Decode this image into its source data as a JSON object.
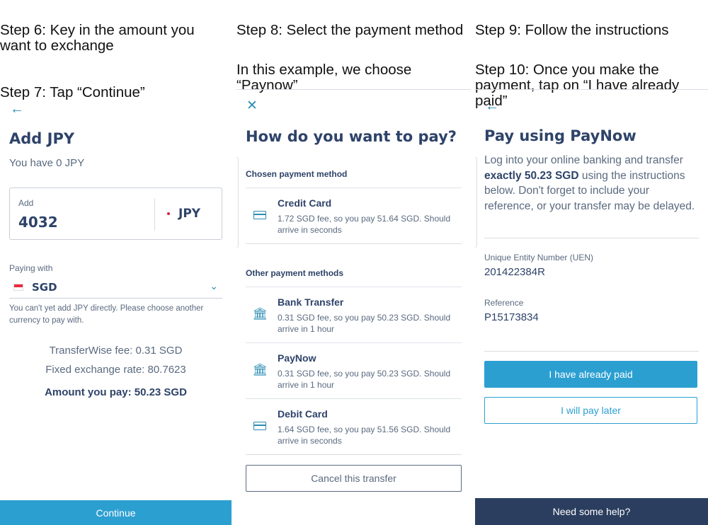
{
  "col1": {
    "caption_a": "Step 6: Key in the amount you\nwant to exchange",
    "caption_b": "Step 7: Tap “Continue”",
    "back_icon": "arrow-left-icon",
    "title": "Add JPY",
    "balance": "You have 0 JPY",
    "amount_label": "Add",
    "amount_value": "4032",
    "amount_currency": "JPY",
    "paying_with_label": "Paying with",
    "paying_with_currency": "SGD",
    "notice": "You can't yet add JPY directly. Please choose another currency to pay with.",
    "fee": "TransferWise fee: 0.31 SGD",
    "rate": "Fixed exchange rate: 80.7623",
    "total": "Amount you pay: 50.23 SGD",
    "continue_label": "Continue"
  },
  "col2": {
    "caption_a": "Step 8: Select the payment method",
    "caption_b": "In this example, we choose\n“Paynow”",
    "close_icon": "close-icon",
    "title": "How do you want to pay?",
    "chosen_head": "Chosen payment method",
    "chosen": {
      "name": "Credit Card",
      "desc": "1.72 SGD fee, so you pay 51.64 SGD. Should arrive in seconds",
      "icon": "credit-card-icon"
    },
    "other_head": "Other payment methods",
    "others": [
      {
        "name": "Bank Transfer",
        "desc": "0.31 SGD fee, so you pay 50.23 SGD. Should arrive in 1 hour",
        "icon": "bank-icon"
      },
      {
        "name": "PayNow",
        "desc": "0.31 SGD fee, so you pay 50.23 SGD. Should arrive in 1 hour",
        "icon": "bank-icon"
      },
      {
        "name": "Debit Card",
        "desc": "1.64 SGD fee, so you pay 51.56 SGD. Should arrive in seconds",
        "icon": "credit-card-icon"
      }
    ],
    "cancel_label": "Cancel this transfer"
  },
  "col3": {
    "caption_a": "Step 9: Follow the instructions",
    "caption_b": "Step 10: Once you make the\npayment, tap on “I have already\npaid”",
    "back_icon": "arrow-left-icon",
    "title": "Pay using PayNow",
    "body_pre": "Log into your online banking and transfer ",
    "body_bold": "exactly 50.23 SGD",
    "body_post": " using the instructions below. Don't forget to include your reference, or your transfer may be delayed.",
    "uen_label": "Unique Entity Number (UEN)",
    "uen_value": "201422384R",
    "ref_label": "Reference",
    "ref_value": "P15173834",
    "paid_label": "I have already paid",
    "later_label": "I will pay later",
    "help_label": "Need some help?"
  },
  "colors": {
    "accent": "#2c9fd1",
    "navy": "#2e4369",
    "help_bar": "#2b3e5f"
  }
}
